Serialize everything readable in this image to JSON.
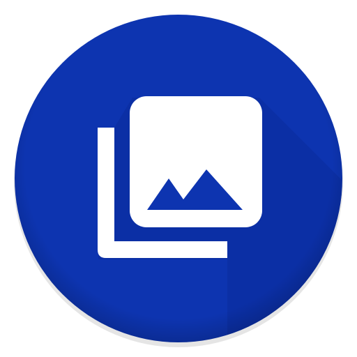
{
  "icon": {
    "name": "gallery-app-icon",
    "glyph": "photo-library-icon",
    "colors": {
      "background": "#0D34B0",
      "background_shadow": "#082A9A",
      "glyph": "#FFFFFF"
    }
  }
}
